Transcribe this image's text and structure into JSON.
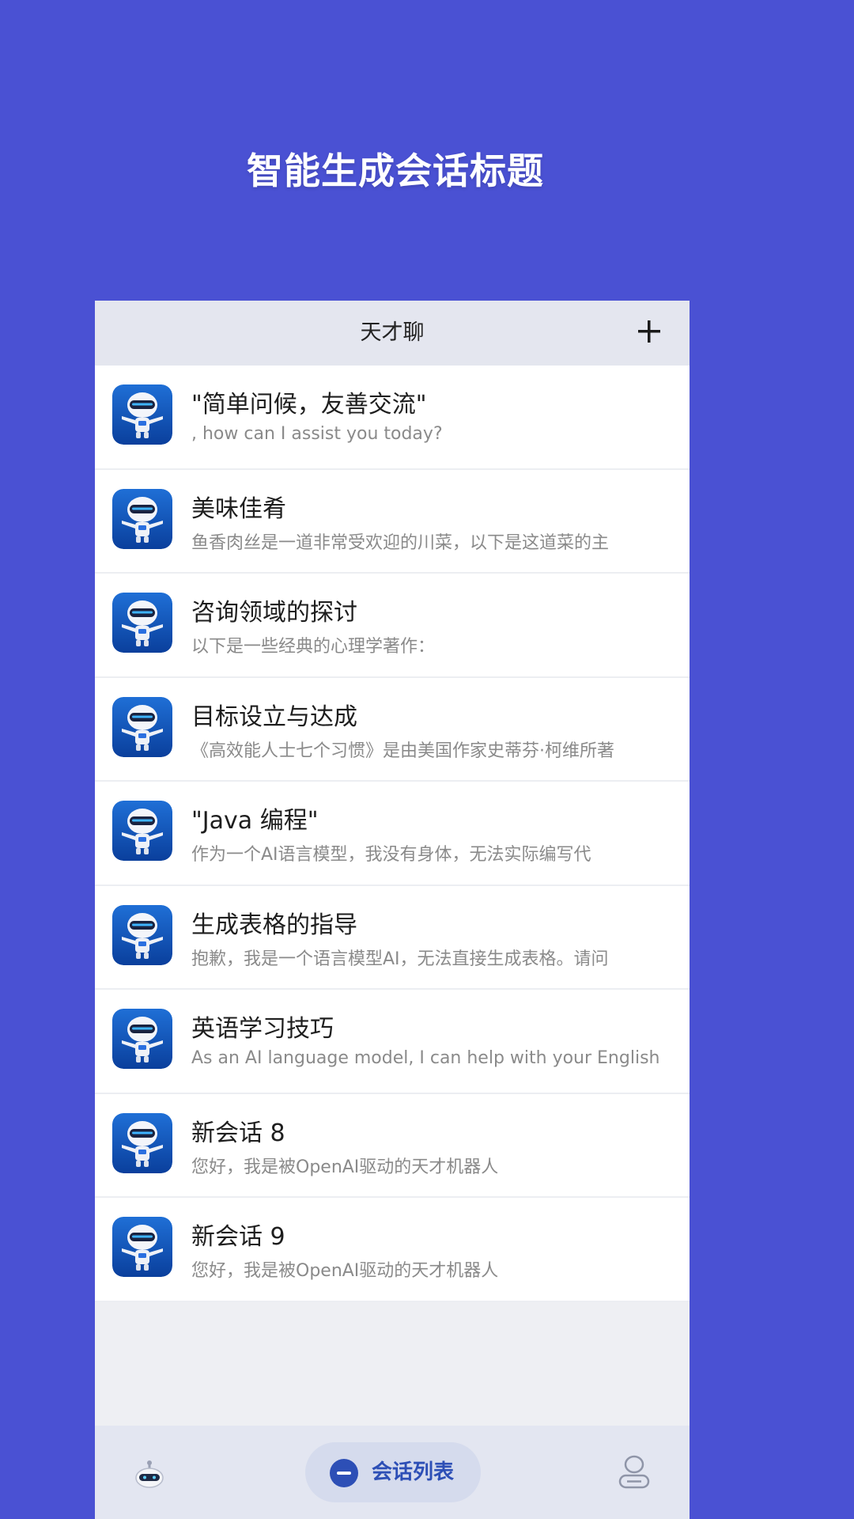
{
  "banner": {
    "headline": "智能生成会话标题"
  },
  "app": {
    "title": "天才聊",
    "add_icon": "plus-icon"
  },
  "colors": {
    "background": "#4a51d3",
    "accent": "#2d4fb6"
  },
  "conversations": [
    {
      "title": "\"简单问候，友善交流\"",
      "preview": ", how can I assist you today?"
    },
    {
      "title": "美味佳肴",
      "preview": "鱼香肉丝是一道非常受欢迎的川菜，以下是这道菜的主"
    },
    {
      "title": "咨询领域的探讨",
      "preview": "以下是一些经典的心理学著作："
    },
    {
      "title": "目标设立与达成",
      "preview": "《高效能人士七个习惯》是由美国作家史蒂芬·柯维所著"
    },
    {
      "title": "\"Java 编程\"",
      "preview": "作为一个AI语言模型，我没有身体，无法实际编写代"
    },
    {
      "title": "生成表格的指导",
      "preview": "抱歉，我是一个语言模型AI，无法直接生成表格。请问"
    },
    {
      "title": "英语学习技巧",
      "preview": "As an AI language model, I can help with your English"
    },
    {
      "title": "新会话 8",
      "preview": "您好，我是被OpenAI驱动的天才机器人"
    },
    {
      "title": "新会话 9",
      "preview": "您好，我是被OpenAI驱动的天才机器人"
    }
  ],
  "tabbar": {
    "bot_icon": "robot-icon",
    "active_label": "会话列表",
    "active_icon": "chat-bubble-icon",
    "profile_icon": "user-icon"
  }
}
